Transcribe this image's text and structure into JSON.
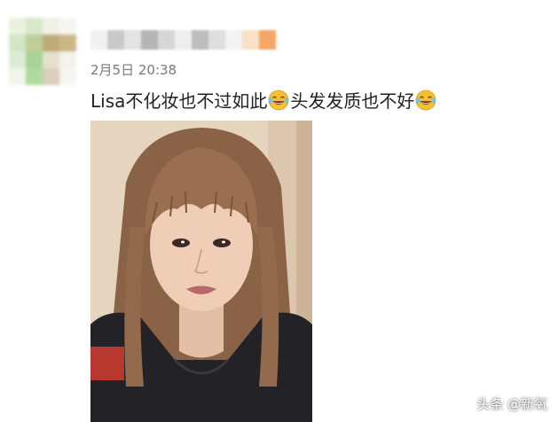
{
  "post": {
    "username_redacted": true,
    "timestamp": "2月5日 20:38",
    "text_part1": "Lisa不化妆也不过如此",
    "text_part2": "头发发质也不好",
    "emoji_icon": "laughing-tears-emoji"
  },
  "photo": {
    "subject": "selfie"
  },
  "watermark": {
    "text": "头条 @新氧"
  },
  "colors": {
    "timestamp": "#7a7a7a",
    "text": "#222222",
    "emoji_face": "#f5c132"
  }
}
